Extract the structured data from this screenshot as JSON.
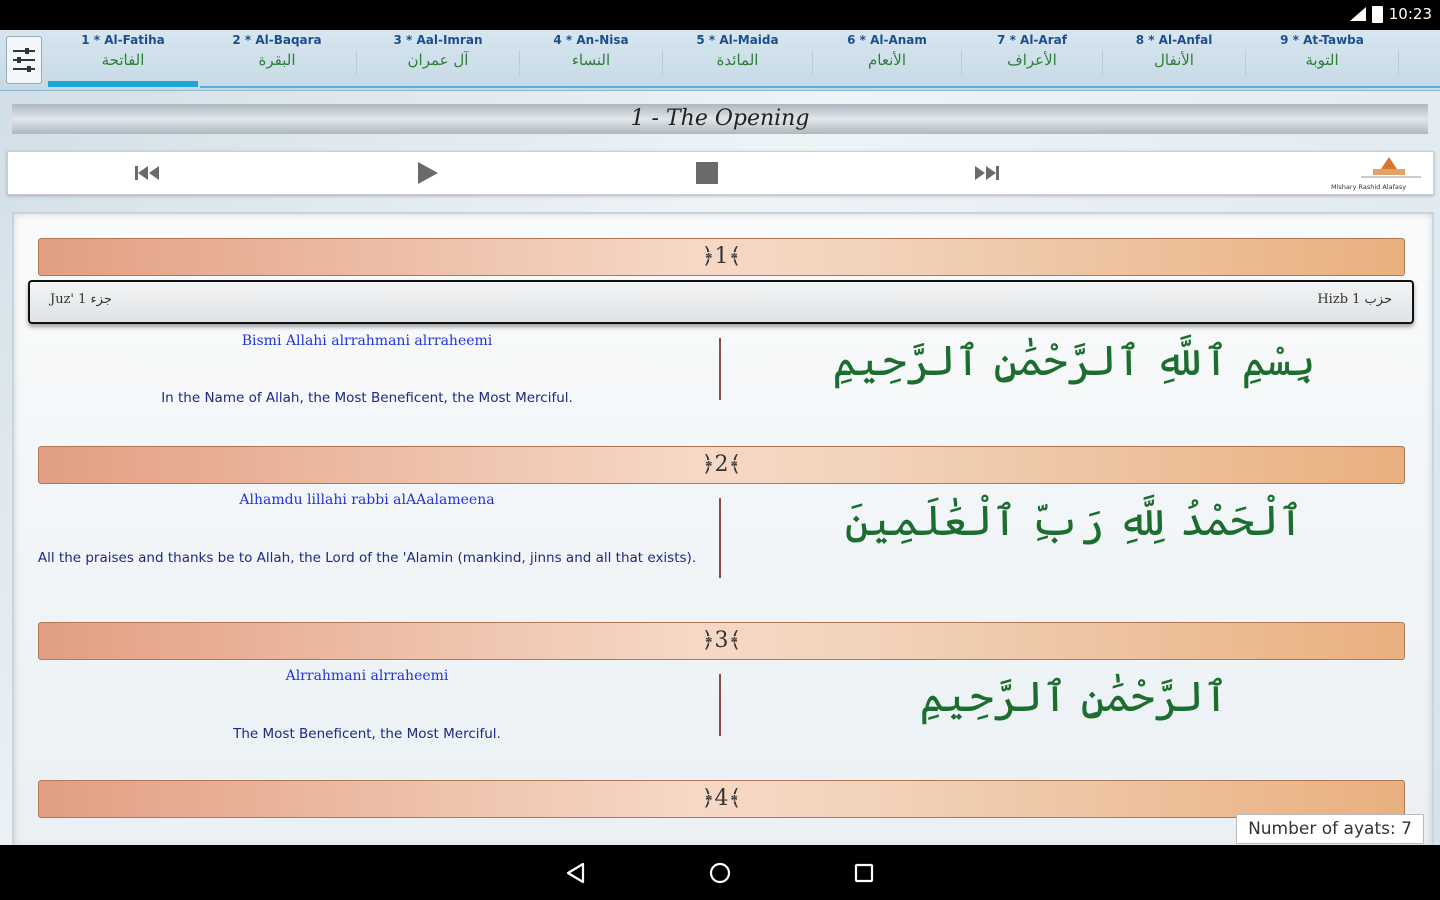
{
  "status_bar": {
    "time": "10:23"
  },
  "tabs": [
    {
      "en": "1 * Al-Fatiha",
      "ar": "الفاتحة"
    },
    {
      "en": "2 * Al-Baqara",
      "ar": "البقرة"
    },
    {
      "en": "3 * Aal-Imran",
      "ar": "آل عمران"
    },
    {
      "en": "4 * An-Nisa",
      "ar": "النساء"
    },
    {
      "en": "5 * Al-Maida",
      "ar": "المائدة"
    },
    {
      "en": "6 * Al-Anam",
      "ar": "الأنعام"
    },
    {
      "en": "7 * Al-Araf",
      "ar": "الأعراف"
    },
    {
      "en": "8 * Al-Anfal",
      "ar": "الأنفال"
    },
    {
      "en": "9 * At-Tawba",
      "ar": "التوبة"
    }
  ],
  "surah_title": "1 - The Opening",
  "player": {
    "reciter": "Mishary Rashid Alafasy"
  },
  "juz_info": {
    "juz": "Juz' 1 جزء",
    "hizb": "Hizb 1 حزب"
  },
  "ayahs": [
    {
      "number": "﴿1﴾",
      "translit": "Bismi Allahi alrrahmani alrraheemi",
      "translation": "In the Name of Allah, the Most Beneficent, the Most Merciful.",
      "arabic": "بِسْمِ ٱللَّهِ ٱلرَّحْمَٰنِ ٱلرَّحِيمِ"
    },
    {
      "number": "﴿2﴾",
      "translit": "Alhamdu lillahi rabbi alAAalameena",
      "translation": "All the praises and thanks be to Allah, the Lord of the 'Alamin (mankind, jinns and all that exists).",
      "arabic": "ٱلْحَمْدُ لِلَّهِ رَبِّ ٱلْعَٰلَمِينَ"
    },
    {
      "number": "﴿3﴾",
      "translit": "Alrrahmani alrraheemi",
      "translation": "The Most Beneficent, the Most Merciful.",
      "arabic": "ٱلرَّحْمَٰنِ ٱلرَّحِيمِ"
    },
    {
      "number": "﴿4﴾"
    }
  ],
  "ayat_count": "Number of ayats: 7",
  "colors": {
    "accent": "#1fa5d8",
    "ayah_bar": "#e9b07f",
    "arabic_text": "#1b6e2e",
    "translit_text": "#2233dd"
  }
}
